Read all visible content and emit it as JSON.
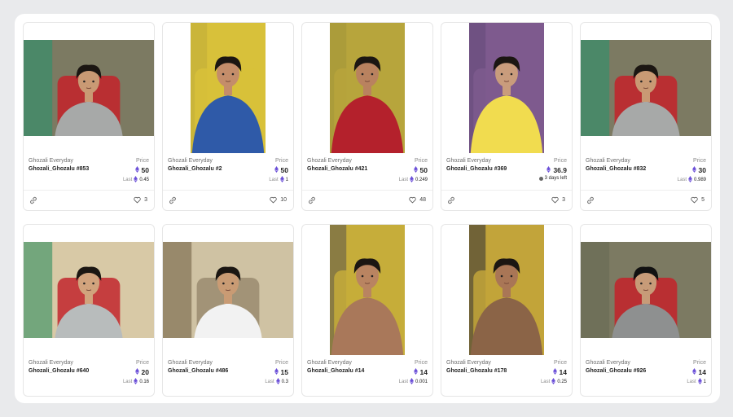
{
  "labels": {
    "price": "Price",
    "last": "Last"
  },
  "colors": {
    "eth": "#6b4fd8",
    "accent_bg": "#e9eaec"
  },
  "cards": [
    {
      "collection": "Ghozali Everyday",
      "name": "Ghozali_Ghozalu #853",
      "price": "50",
      "last": "0.45",
      "likes": "3",
      "photo": "landscape",
      "bg": "room-red-chair"
    },
    {
      "collection": "Ghozali Everyday",
      "name": "Ghozali_Ghozalu #2",
      "price": "50",
      "last": "1",
      "likes": "10",
      "photo": "portrait",
      "bg": "yellow-wall-blue-shirt"
    },
    {
      "collection": "Ghozali Everyday",
      "name": "Ghozali_Ghozalu #421",
      "price": "50",
      "last": "0.249",
      "likes": "48",
      "photo": "portrait",
      "bg": "yellow-wall-red-shirt"
    },
    {
      "collection": "Ghozali Everyday",
      "name": "Ghozali_Ghozalu #369",
      "price": "36.9",
      "last_text": "3 days left",
      "likes": "3",
      "photo": "portrait",
      "bg": "purple-wall-yellow-shirt"
    },
    {
      "collection": "Ghozali Everyday",
      "name": "Ghozali_Ghozalu #832",
      "price": "30",
      "last": "0.989",
      "likes": "5",
      "photo": "landscape",
      "bg": "room-red-chair"
    },
    {
      "collection": "Ghozali Everyday",
      "name": "Ghozali_Ghozalu #640",
      "price": "20",
      "last": "0.16",
      "photo": "landscape",
      "bg": "room-red-chair-light"
    },
    {
      "collection": "Ghozali Everyday",
      "name": "Ghozali_Ghozalu #486",
      "price": "15",
      "last": "0.3",
      "photo": "landscape",
      "bg": "room-shelf-white-shirt"
    },
    {
      "collection": "Ghozali Everyday",
      "name": "Ghozali_Ghozalu #14",
      "price": "14",
      "last": "0.001",
      "photo": "portrait",
      "bg": "yellow-wall-shirtless"
    },
    {
      "collection": "Ghozali Everyday",
      "name": "Ghozali_Ghozalu #178",
      "price": "14",
      "last": "0.25",
      "photo": "portrait",
      "bg": "yellow-wall-shirtless-dark"
    },
    {
      "collection": "Ghozali Everyday",
      "name": "Ghozali_Ghozalu #926",
      "price": "14",
      "last": "1",
      "photo": "landscape",
      "bg": "room-red-chair-hair"
    }
  ]
}
